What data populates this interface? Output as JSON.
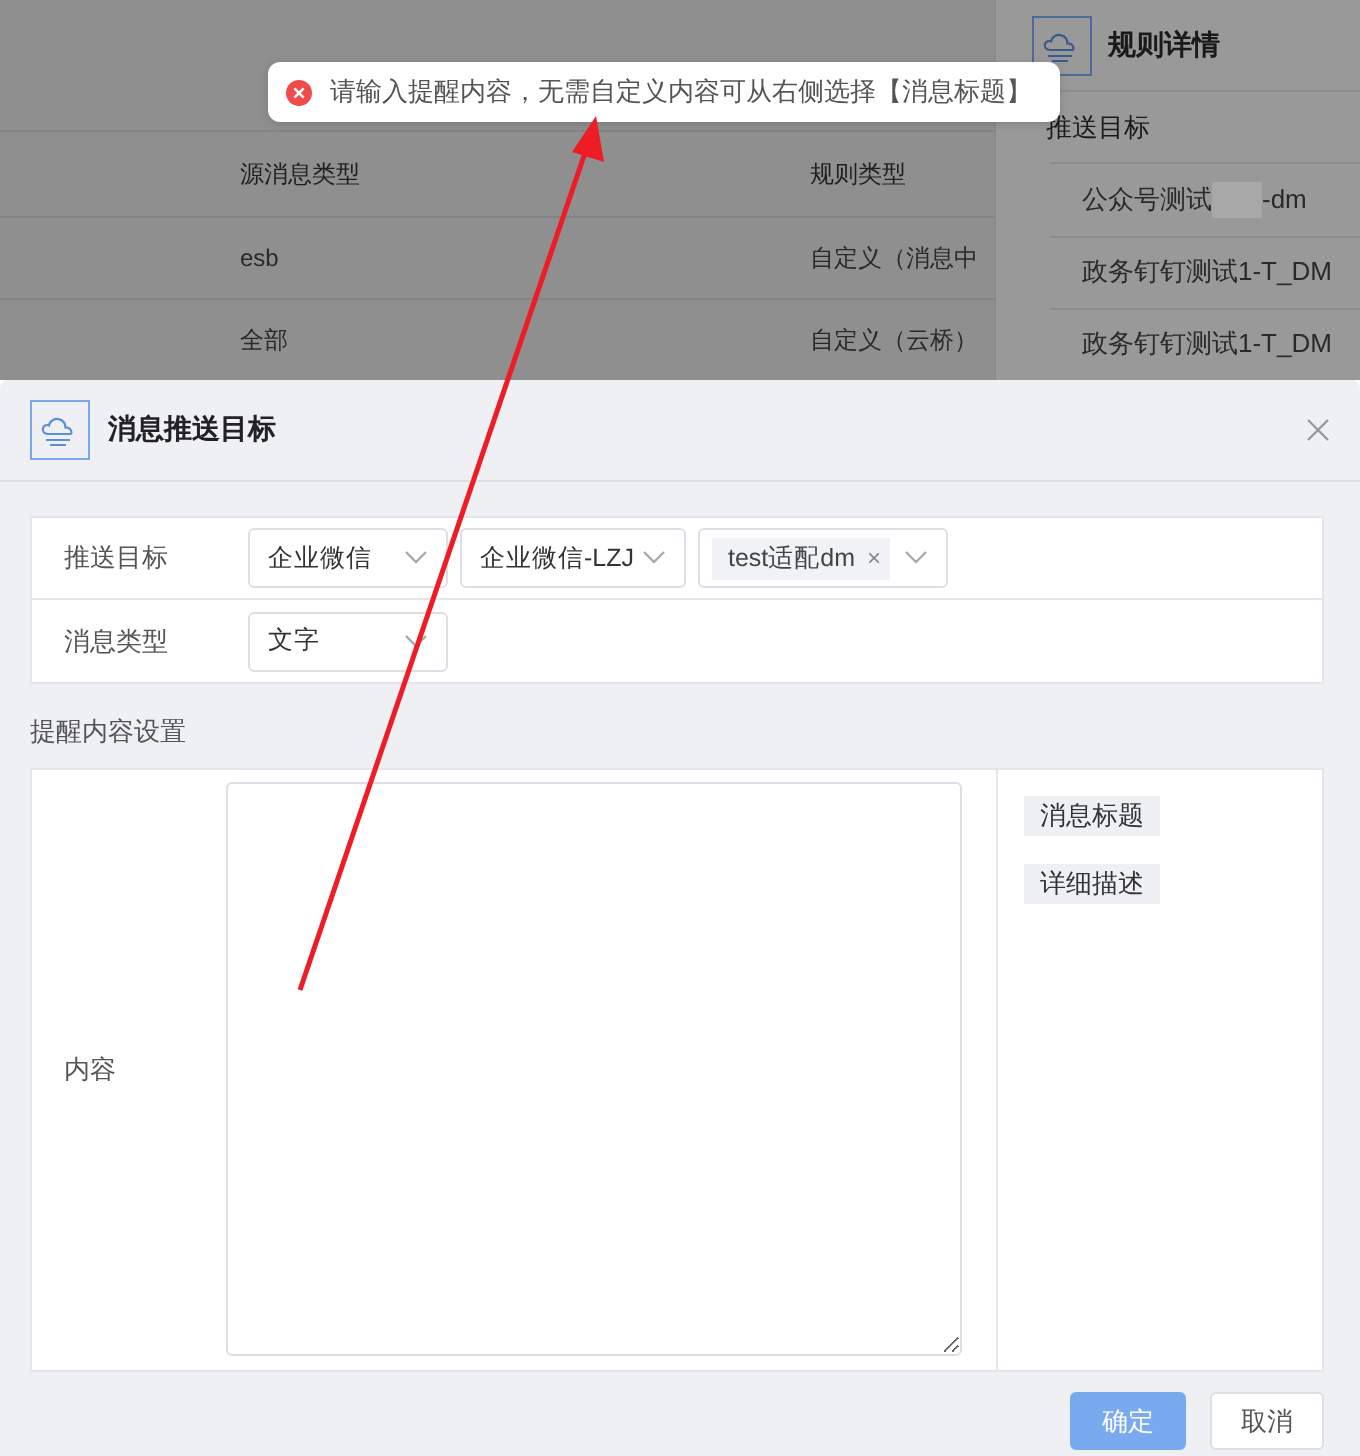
{
  "background": {
    "table": {
      "columns": [
        "源消息类型",
        "规则类型"
      ],
      "rows": [
        [
          "esb",
          "自定义（消息中"
        ],
        [
          "全部",
          "自定义（云桥）"
        ]
      ]
    },
    "detail_panel": {
      "title": "规则详情",
      "section": "推送目标",
      "items": [
        {
          "text": "公众号测试",
          "redacted": true,
          "suffix": "-dm"
        },
        {
          "text": "政务钉钉测试1-T_DM",
          "redacted": false
        },
        {
          "text": "政务钉钉测试1-T_DM",
          "redacted": false
        }
      ]
    }
  },
  "toast": {
    "kind": "error",
    "message": "请输入提醒内容，无需自定义内容可从右侧选择【消息标题】"
  },
  "dialog": {
    "title": "消息推送目标",
    "fields": [
      {
        "label": "推送目标",
        "controls": [
          {
            "kind": "select",
            "value": "企业微信"
          },
          {
            "kind": "select",
            "value": "企业微信-LZJ"
          },
          {
            "kind": "multi",
            "tags": [
              {
                "label": "test适配dm",
                "remove": "×"
              }
            ]
          }
        ]
      },
      {
        "label": "消息类型",
        "controls": [
          {
            "kind": "select",
            "value": "文字"
          }
        ]
      }
    ],
    "section_title": "提醒内容设置",
    "content": {
      "label": "内容",
      "insert_tags": [
        "消息标题",
        "详细描述"
      ]
    },
    "buttons": [
      {
        "label": "确定",
        "kind": "primary",
        "disabled": true
      },
      {
        "label": "取消",
        "kind": "default",
        "disabled": false
      }
    ]
  },
  "annotation": {
    "kind": "arrow"
  }
}
